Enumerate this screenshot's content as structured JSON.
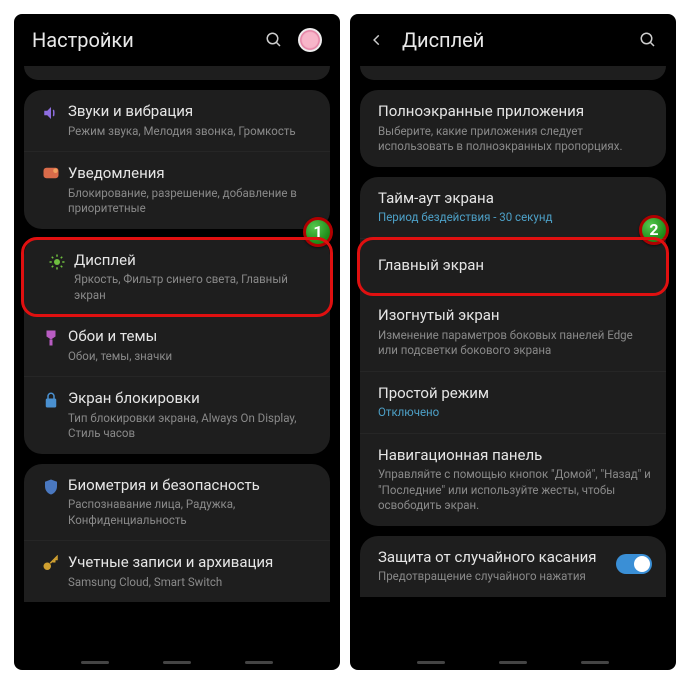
{
  "left": {
    "title": "Настройки",
    "badge": "1",
    "items": [
      {
        "icon": "sound",
        "title": "Звуки и вибрация",
        "subtitle": "Режим звука, Мелодия звонка, Громкость"
      },
      {
        "icon": "notif",
        "title": "Уведомления",
        "subtitle": "Блокирование, разрешение, добавление в приоритетные"
      },
      {
        "icon": "display",
        "title": "Дисплей",
        "subtitle": "Яркость, Фильтр синего света, Главный экран",
        "highlight": true
      },
      {
        "icon": "wallpaper",
        "title": "Обои и темы",
        "subtitle": "Обои, темы, значки"
      },
      {
        "icon": "lock",
        "title": "Экран блокировки",
        "subtitle": "Тип блокировки экрана, Always On Display, Стиль часов"
      },
      {
        "icon": "biometric",
        "title": "Биометрия и безопасность",
        "subtitle": "Распознавание лица, Радужка, Конфиденциальность"
      },
      {
        "icon": "accounts",
        "title": "Учетные записи и архивация",
        "subtitle": "Samsung Cloud, Smart Switch"
      }
    ]
  },
  "right": {
    "title": "Дисплей",
    "badge": "2",
    "items": [
      {
        "title": "Полноэкранные приложения",
        "subtitle": "Выберите, какие приложения следует использовать в полноэкранных пропорциях."
      },
      {
        "title": "Тайм-аут экрана",
        "subtitle": "Период бездействия - 30 секунд",
        "accent": true
      },
      {
        "title": "Главный экран",
        "highlight": true
      },
      {
        "title": "Изогнутый экран",
        "subtitle": "Изменение параметров боковых панелей Edge или подсветки бокового экрана"
      },
      {
        "title": "Простой режим",
        "subtitle": "Отключено",
        "accent": true
      },
      {
        "title": "Навигационная панель",
        "subtitle": "Управляйте с помощью кнопок \"Домой\", \"Назад\" и \"Последние\" или используйте жесты, чтобы освободить экран."
      },
      {
        "title": "Защита от случайного касания",
        "subtitle": "Предотвращение случайного нажатия",
        "toggle": true
      }
    ]
  }
}
